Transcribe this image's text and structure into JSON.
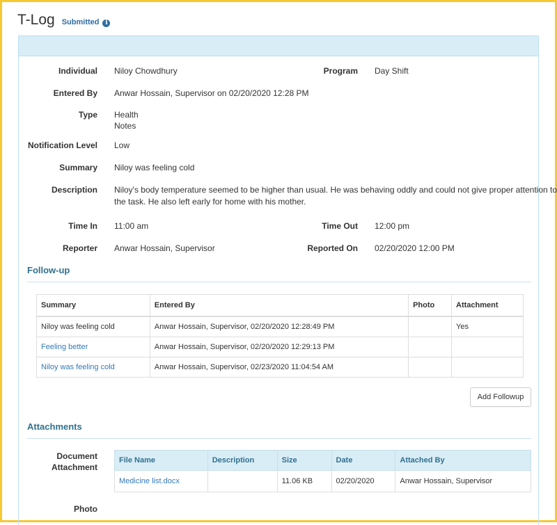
{
  "header": {
    "title": "T-Log",
    "status": "Submitted",
    "info_icon": "info-icon"
  },
  "details": {
    "individual_label": "Individual",
    "individual": "Niloy Chowdhury",
    "program_label": "Program",
    "program": "Day Shift",
    "entered_by_label": "Entered By",
    "entered_by": "Anwar Hossain, Supervisor on 02/20/2020 12:28 PM",
    "type_label": "Type",
    "type_line1": "Health",
    "type_line2": "Notes",
    "notification_label": "Notification Level",
    "notification": "Low",
    "summary_label": "Summary",
    "summary": "Niloy was feeling cold",
    "description_label": "Description",
    "description_line1": "Niloy's body temperature seemed to be higher than usual. He was behaving oddly and could not give proper attention to",
    "description_line2": "the task. He also left early for home with his mother.",
    "time_in_label": "Time In",
    "time_in": "11:00 am",
    "time_out_label": "Time Out",
    "time_out": "12:00 pm",
    "reporter_label": "Reporter",
    "reporter": "Anwar Hossain, Supervisor",
    "reported_on_label": "Reported On",
    "reported_on": "02/20/2020 12:00 PM"
  },
  "followup": {
    "title": "Follow-up",
    "headers": [
      "Summary",
      "Entered By",
      "Photo",
      "Attachment"
    ],
    "rows": [
      {
        "summary": "Niloy was feeling cold",
        "entered_by": "Anwar Hossain, Supervisor, 02/20/2020 12:28:49 PM",
        "photo": "",
        "attachment": "Yes"
      },
      {
        "summary": "Feeling better",
        "entered_by": "Anwar Hossain, Supervisor, 02/20/2020 12:29:13 PM",
        "photo": "",
        "attachment": ""
      },
      {
        "summary": "Niloy was feeling cold",
        "entered_by": "Anwar Hossain, Supervisor, 02/23/2020 11:04:54 AM",
        "photo": "",
        "attachment": ""
      }
    ],
    "add_button": "Add Followup"
  },
  "attachments": {
    "title": "Attachments",
    "doc_label_1": "Document",
    "doc_label_2": "Attachment",
    "headers": [
      "File Name",
      "Description",
      "Size",
      "Date",
      "Attached By"
    ],
    "rows": [
      {
        "file_name": "Medicine list.docx",
        "description": "",
        "size": "11.06 KB",
        "date": "02/20/2020",
        "attached_by": "Anwar Hossain, Supervisor"
      }
    ],
    "photo_label": "Photo"
  }
}
